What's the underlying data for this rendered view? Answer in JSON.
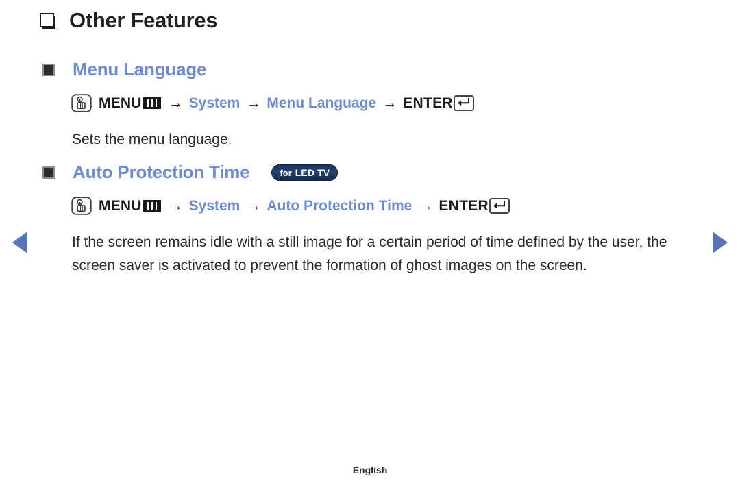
{
  "page": {
    "section_title": "Other Features",
    "footer_language": "English",
    "accent_blue": "#6e8ccd",
    "arrow_blue": "#5577b8",
    "badge_navy": "#1b3362",
    "text_color": "#2e2a2c"
  },
  "nav_arrows": {
    "previous": "previous-page",
    "next": "next-page"
  },
  "features": [
    {
      "heading": "Menu Language",
      "badge": null,
      "path": {
        "press_icon": "press-hand-icon",
        "menu_label": "MENU",
        "menu_icon": "menu-bars-icon",
        "arrow": "→",
        "steps": [
          "System",
          "Menu Language"
        ],
        "enter_label": "ENTER",
        "enter_icon": "enter-return-icon"
      },
      "description": "Sets the menu language."
    },
    {
      "heading": "Auto Protection Time",
      "badge": {
        "prefix": "for",
        "model": "LED TV"
      },
      "path": {
        "press_icon": "press-hand-icon",
        "menu_label": "MENU",
        "menu_icon": "menu-bars-icon",
        "arrow": "→",
        "steps": [
          "System",
          "Auto Protection Time"
        ],
        "enter_label": "ENTER",
        "enter_icon": "enter-return-icon"
      },
      "description": "If the screen remains idle with a still image for a certain period of time defined by the user, the screen saver is activated to prevent the formation of ghost images on the screen."
    }
  ]
}
